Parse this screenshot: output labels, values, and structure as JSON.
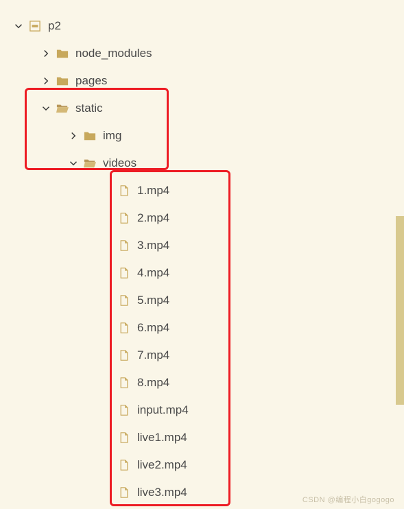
{
  "root": {
    "name": "p2",
    "expanded": true
  },
  "children": [
    {
      "name": "node_modules",
      "type": "folder",
      "expanded": false
    },
    {
      "name": "pages",
      "type": "folder",
      "expanded": false
    }
  ],
  "static": {
    "name": "static",
    "expanded": true,
    "children": [
      {
        "name": "img",
        "type": "folder",
        "expanded": false
      },
      {
        "name": "videos",
        "type": "folder",
        "expanded": true
      }
    ]
  },
  "videos_files": [
    "1.mp4",
    "2.mp4",
    "3.mp4",
    "4.mp4",
    "5.mp4",
    "6.mp4",
    "7.mp4",
    "8.mp4",
    "input.mp4",
    "live1.mp4",
    "live2.mp4",
    "live3.mp4"
  ],
  "watermark": "CSDN @编程小白gogogo"
}
